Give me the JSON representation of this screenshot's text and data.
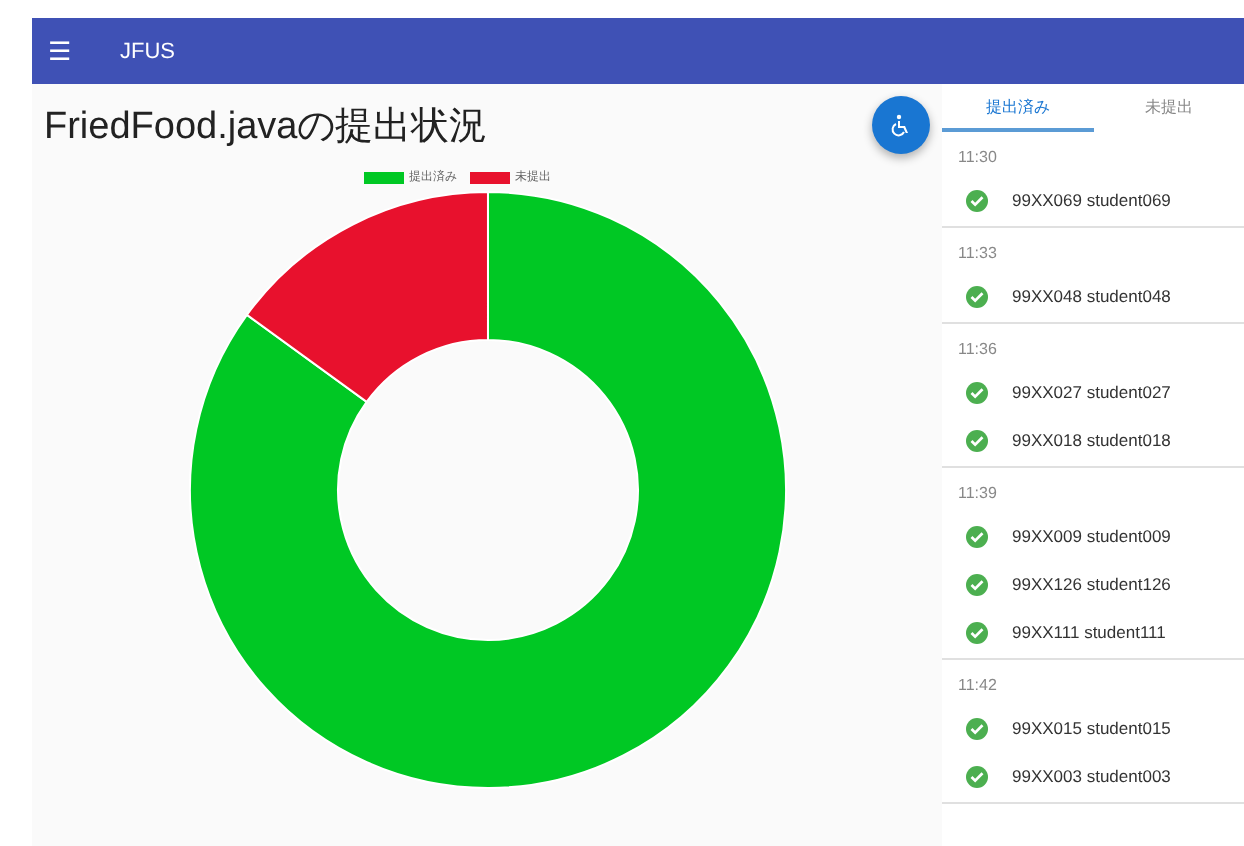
{
  "app_bar": {
    "menu_icon": "☰",
    "title": "JFUS"
  },
  "page": {
    "title": "FriedFood.javaの提出状況"
  },
  "legend": [
    {
      "label": "提出済み",
      "color": "#00c824"
    },
    {
      "label": "未提出",
      "color": "#e8112d"
    }
  ],
  "tabs": [
    {
      "label": "提出済み",
      "selected": true
    },
    {
      "label": "未提出",
      "selected": false
    }
  ],
  "groups": [
    {
      "time": "11:30",
      "items": [
        {
          "text": "99XX069 student069"
        }
      ]
    },
    {
      "time": "11:33",
      "items": [
        {
          "text": "99XX048 student048"
        }
      ]
    },
    {
      "time": "11:36",
      "items": [
        {
          "text": "99XX027 student027"
        },
        {
          "text": "99XX018 student018"
        }
      ]
    },
    {
      "time": "11:39",
      "items": [
        {
          "text": "99XX009 student009"
        },
        {
          "text": "99XX126 student126"
        },
        {
          "text": "99XX111 student111"
        }
      ]
    },
    {
      "time": "11:42",
      "items": [
        {
          "text": "99XX015 student015"
        },
        {
          "text": "99XX003 student003"
        }
      ]
    }
  ]
}
